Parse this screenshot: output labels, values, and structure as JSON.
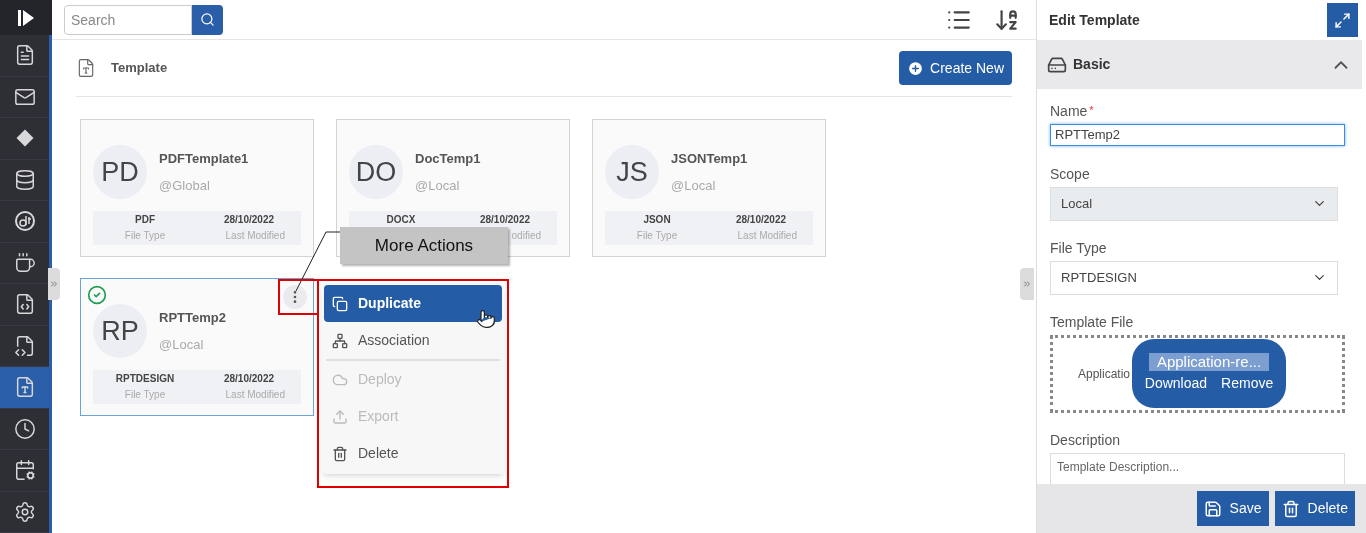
{
  "sidebar": {
    "items": [
      {
        "selected": false
      },
      {
        "selected": false
      },
      {
        "selected": false
      },
      {
        "selected": false
      },
      {
        "selected": false
      },
      {
        "selected": false
      },
      {
        "selected": false
      },
      {
        "selected": false
      },
      {
        "selected": true
      },
      {
        "selected": false
      },
      {
        "selected": false
      },
      {
        "selected": false
      }
    ]
  },
  "toolbar": {
    "search": {
      "placeholder": "Search"
    }
  },
  "header": {
    "title": "Template",
    "create_button": "Create New"
  },
  "cards": [
    {
      "initials": "PD",
      "name": "PDFTemplate1",
      "scope": "@Global",
      "file_type": "PDF",
      "file_type_label": "File Type",
      "modified": "28/10/2022",
      "modified_label": "Last Modified",
      "selected": false
    },
    {
      "initials": "DO",
      "name": "DocTemp1",
      "scope": "@Local",
      "file_type": "DOCX",
      "modified": "28/10/2022",
      "modified_label": "odified",
      "selected": false
    },
    {
      "initials": "JS",
      "name": "JSONTemp1",
      "scope": "@Local",
      "file_type": "JSON",
      "file_type_label": "File Type",
      "modified": "28/10/2022",
      "modified_label": "Last Modified",
      "selected": false
    },
    {
      "initials": "RP",
      "name": "RPTTemp2",
      "scope": "@Local",
      "file_type": "RPTDESIGN",
      "file_type_label": "File Type",
      "modified": "28/10/2022",
      "modified_label": "Last Modified",
      "selected": true
    }
  ],
  "tooltip": {
    "text": "More Actions"
  },
  "menu": {
    "items": [
      {
        "label": "Duplicate",
        "selected": true,
        "disabled": false,
        "separator_before": false
      },
      {
        "label": "Association",
        "selected": false,
        "disabled": false,
        "separator_before": false
      },
      {
        "label": "Deploy",
        "selected": false,
        "disabled": true,
        "separator_before": true
      },
      {
        "label": "Export",
        "selected": false,
        "disabled": true,
        "separator_before": false
      },
      {
        "label": "Delete",
        "selected": false,
        "disabled": false,
        "separator_before": false
      }
    ]
  },
  "panel": {
    "title": "Edit Template",
    "section": {
      "title": "Basic",
      "expanded": true
    },
    "name": {
      "label": "Name",
      "required": true,
      "required_mark": "*",
      "value": "RPTTemp2"
    },
    "scope": {
      "label": "Scope",
      "value": "Local",
      "disabled": true
    },
    "file_type": {
      "label": "File Type",
      "value": "RPTDESIGN",
      "disabled": false
    },
    "template_file": {
      "label": "Template File",
      "file_text": "Applicatio",
      "overlay_name": "Application-re...",
      "download": "Download",
      "remove": "Remove"
    },
    "description": {
      "label": "Description",
      "placeholder": "Template Description..."
    },
    "buttons": [
      {
        "label": "Save",
        "kind": "save"
      },
      {
        "label": "Delete",
        "kind": "delete"
      }
    ]
  }
}
